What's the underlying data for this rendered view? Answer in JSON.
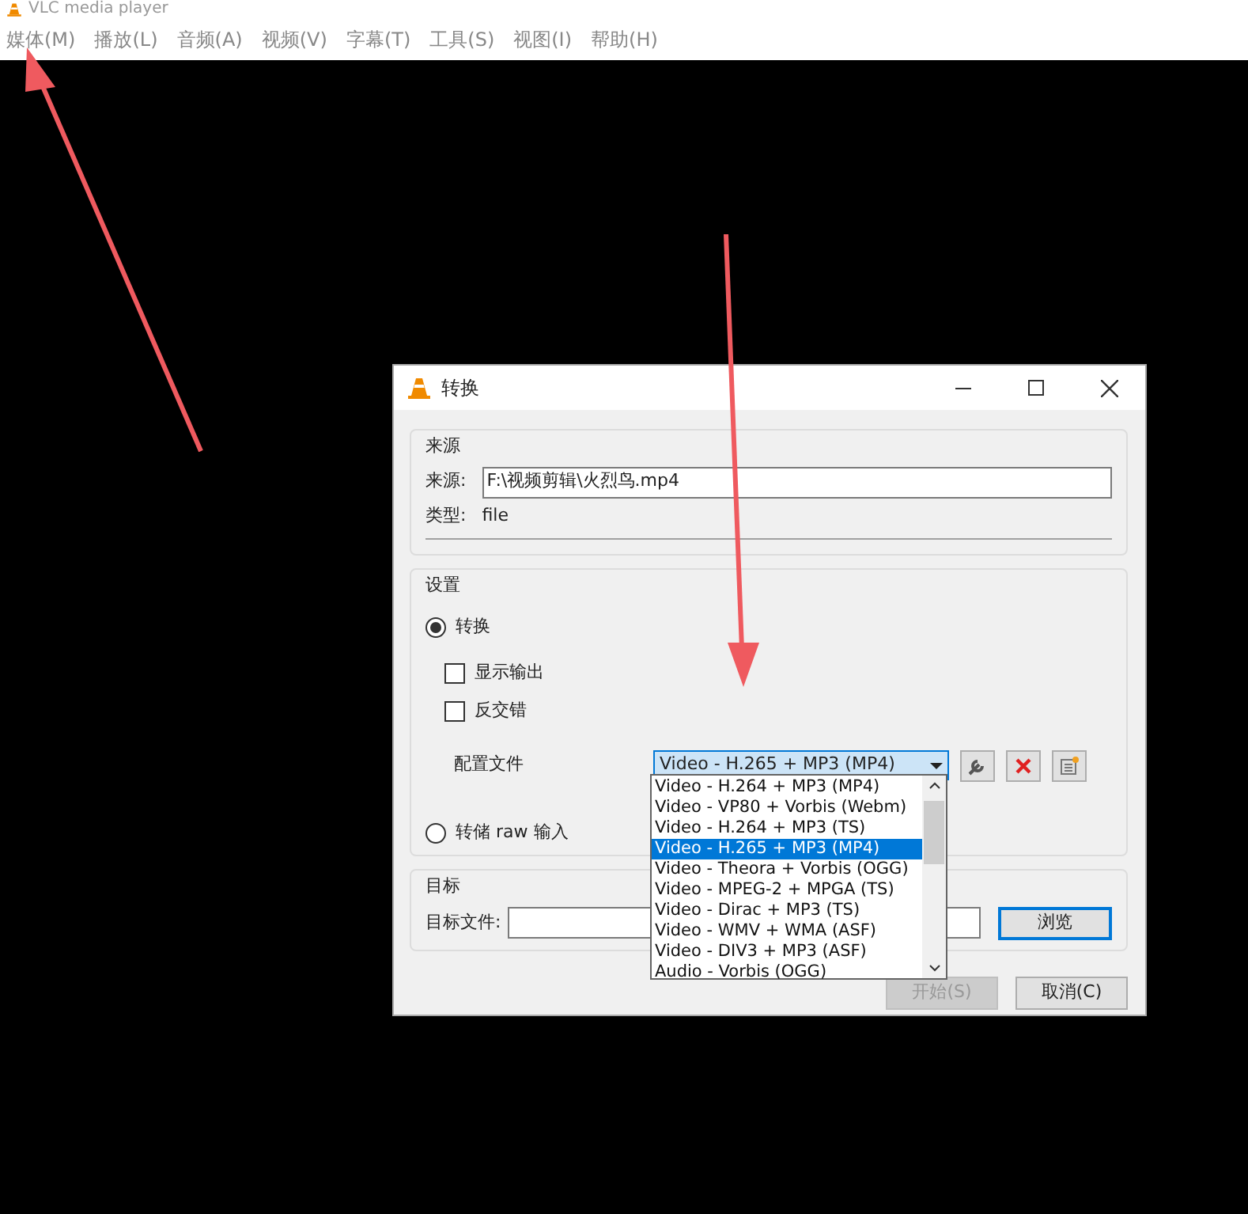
{
  "window": {
    "title": "VLC media player"
  },
  "menu": [
    "媒体(M)",
    "播放(L)",
    "音频(A)",
    "视频(V)",
    "字幕(T)",
    "工具(S)",
    "视图(I)",
    "帮助(H)"
  ],
  "dialog": {
    "title": "转换",
    "source_group": {
      "title": "来源",
      "source_label": "来源:",
      "source_value": "F:\\视频剪辑\\火烈鸟.mp4",
      "type_label": "类型:",
      "type_value": "file"
    },
    "settings_group": {
      "title": "设置",
      "options": [
        {
          "kind": "radio",
          "label": "转换",
          "checked": true
        },
        {
          "kind": "checkbox",
          "label": "显示输出",
          "checked": false
        },
        {
          "kind": "checkbox",
          "label": "反交错",
          "checked": false
        }
      ],
      "profile_label": "配置文件",
      "profile_value": "Video - H.265 + MP3 (MP4)",
      "profile_options": [
        {
          "label": "Video - H.264 + MP3 (MP4)",
          "selected": false
        },
        {
          "label": "Video - VP80 + Vorbis (Webm)",
          "selected": false
        },
        {
          "label": "Video - H.264 + MP3 (TS)",
          "selected": false
        },
        {
          "label": "Video - H.265 + MP3 (MP4)",
          "selected": true
        },
        {
          "label": "Video - Theora + Vorbis (OGG)",
          "selected": false
        },
        {
          "label": "Video - MPEG-2 + MPGA (TS)",
          "selected": false
        },
        {
          "label": "Video - Dirac + MP3 (TS)",
          "selected": false
        },
        {
          "label": "Video - WMV + WMA (ASF)",
          "selected": false
        },
        {
          "label": "Video - DIV3 + MP3 (ASF)",
          "selected": false
        },
        {
          "label": "Audio - Vorbis (OGG)",
          "selected": false
        }
      ],
      "raw_option": {
        "label": "转储 raw 输入",
        "checked": false
      }
    },
    "target_group": {
      "title": "目标",
      "file_label": "目标文件:",
      "browse": "浏览"
    },
    "buttons": [
      {
        "label": "开始(S)",
        "disabled": true
      },
      {
        "label": "取消(C)",
        "disabled": false
      }
    ]
  }
}
